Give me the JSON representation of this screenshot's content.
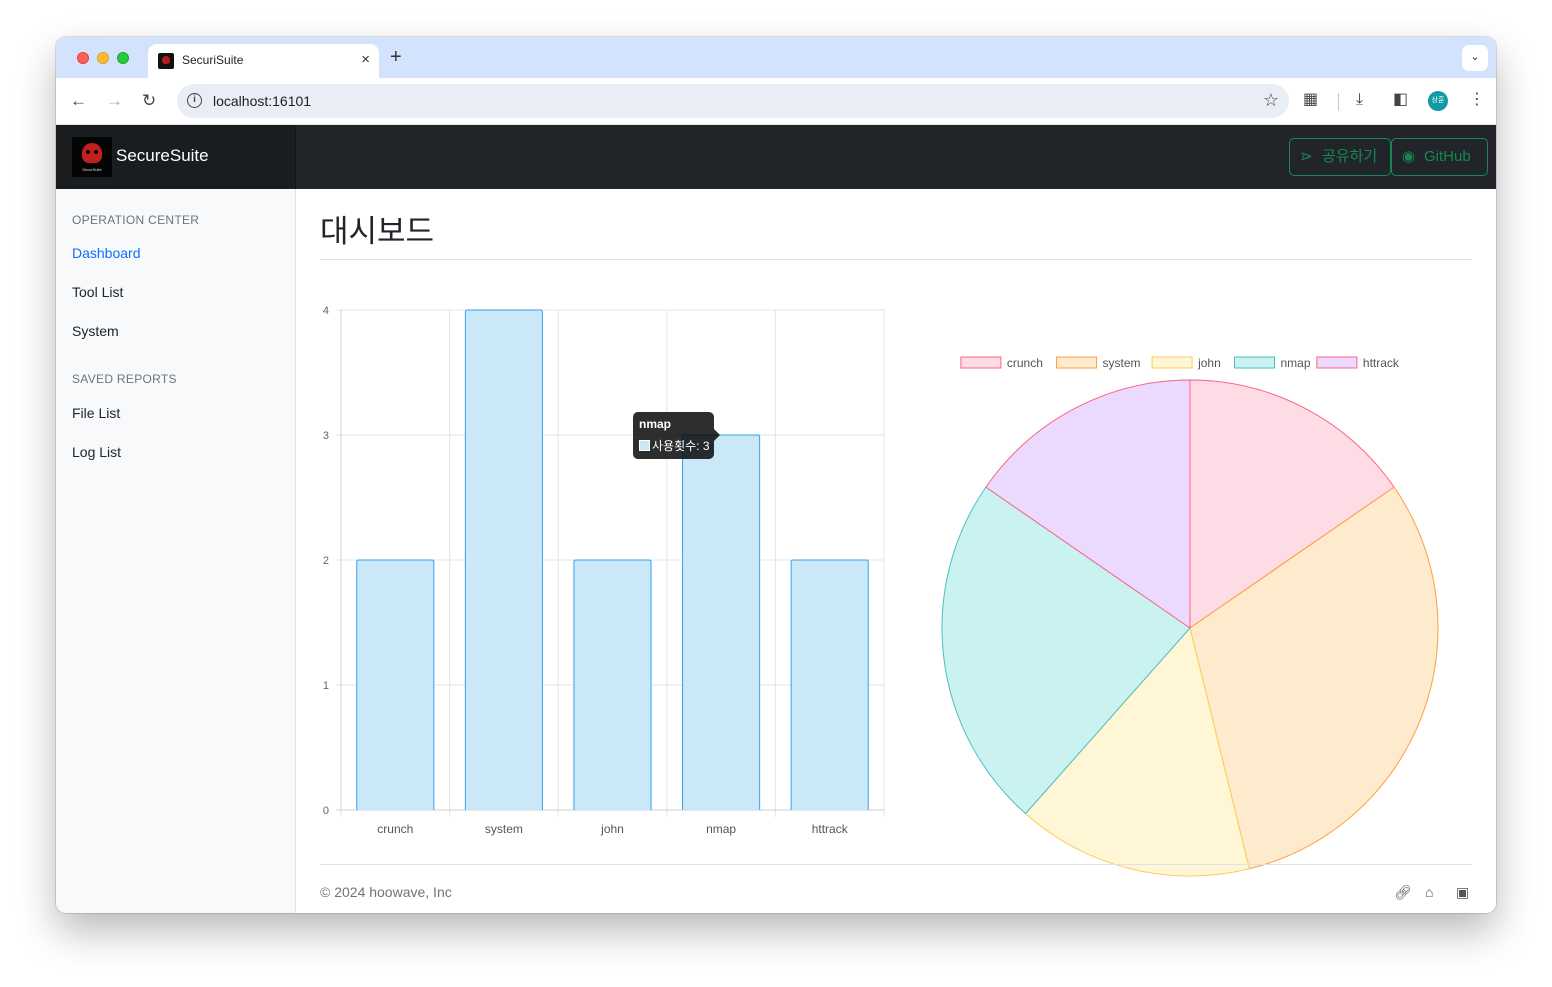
{
  "browser": {
    "tab_title": "SecuriSuite",
    "tab_close": "×",
    "new_tab": "+",
    "url": "localhost:16101",
    "profile_initials": "상훈"
  },
  "navbar": {
    "brand_name": "SecureSuite",
    "logo_text": "SecurSuite",
    "share_label": "공유하기",
    "github_label": "GitHub"
  },
  "sidebar": {
    "section1_heading": "OPERATION CENTER",
    "section1_items": [
      "Dashboard",
      "Tool List",
      "System"
    ],
    "section2_heading": "SAVED REPORTS",
    "section2_items": [
      "File List",
      "Log List"
    ]
  },
  "main": {
    "page_title": "대시보드",
    "footer_text": "© 2024 hoowave, Inc"
  },
  "tooltip": {
    "title": "nmap",
    "label": "사용횟수: 3"
  },
  "colors": {
    "bar_fill": "#cbe8f9",
    "bar_border": "#36a2eb",
    "crunch_fill": "#fddce5",
    "crunch_border": "#ff6384",
    "system_fill": "#feebcd",
    "system_border": "#ff9f40",
    "john_fill": "#fff6d6",
    "john_border": "#ffcd56",
    "nmap_fill": "#caf2f1",
    "nmap_border": "#4bc0c0",
    "httrack_fill": "#ebdafe",
    "httrack_border": "#ff6384"
  },
  "chart_data": [
    {
      "type": "bar",
      "categories": [
        "crunch",
        "system",
        "john",
        "nmap",
        "httrack"
      ],
      "values": [
        2,
        4,
        2,
        3,
        2
      ],
      "ylim": [
        0,
        4
      ],
      "yticks": [
        "0",
        "1",
        "2",
        "3",
        "4"
      ],
      "grid": true,
      "legend": "none"
    },
    {
      "type": "pie",
      "labels": [
        "crunch",
        "system",
        "john",
        "nmap",
        "httrack"
      ],
      "values": [
        2,
        4,
        2,
        3,
        2
      ],
      "legend": "top"
    }
  ]
}
